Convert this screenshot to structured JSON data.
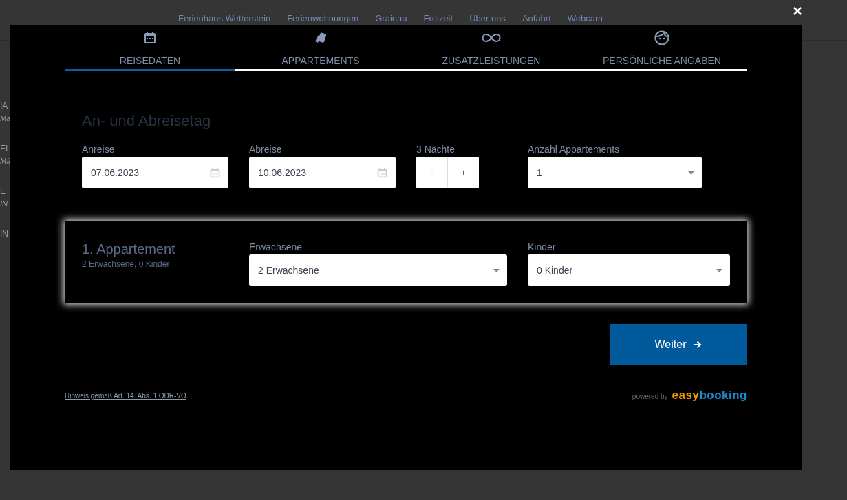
{
  "background": {
    "nav_links": [
      "Ferienhaus Wetterstein",
      "Ferienwohnungen",
      "Grainau",
      "Freizeit",
      "Über uns",
      "Anfahrt",
      "Webcam"
    ],
    "side_fragments": [
      "IA",
      "Ma",
      "EI",
      "Mä",
      "E",
      "IN",
      "IN"
    ]
  },
  "modal": {
    "close": "×",
    "steps": [
      {
        "label": "REISEDATEN",
        "selected": true
      },
      {
        "label": "APPARTEMENTS",
        "selected": false
      },
      {
        "label": "ZUSATZLEISTUNGEN",
        "selected": false
      },
      {
        "label": "PERSÖNLICHE ANGABEN",
        "selected": false
      }
    ],
    "heading": "An- und Abreisetag",
    "arrival": {
      "label": "Anreise",
      "value": "07.06.2023"
    },
    "departure": {
      "label": "Abreise",
      "value": "10.06.2023"
    },
    "nights": {
      "label": "3 Nächte",
      "minus": "-",
      "plus": "+"
    },
    "apartment_count": {
      "label": "Anzahl Appartements",
      "value": "1"
    },
    "apartment": {
      "title": "1. Appartement",
      "summary": "2 Erwachsene, 0 Kinder",
      "adults": {
        "label": "Erwachsene",
        "value": "2 Erwachsene"
      },
      "children": {
        "label": "Kinder",
        "value": "0 Kinder"
      }
    },
    "next_button": "Weiter",
    "footer_link": "Hinweis gemäß Art. 14. Abs. 1 ODR-VO",
    "powered_by": "powered by",
    "logo": {
      "part_1": "easy",
      "part_2": "booking"
    }
  }
}
